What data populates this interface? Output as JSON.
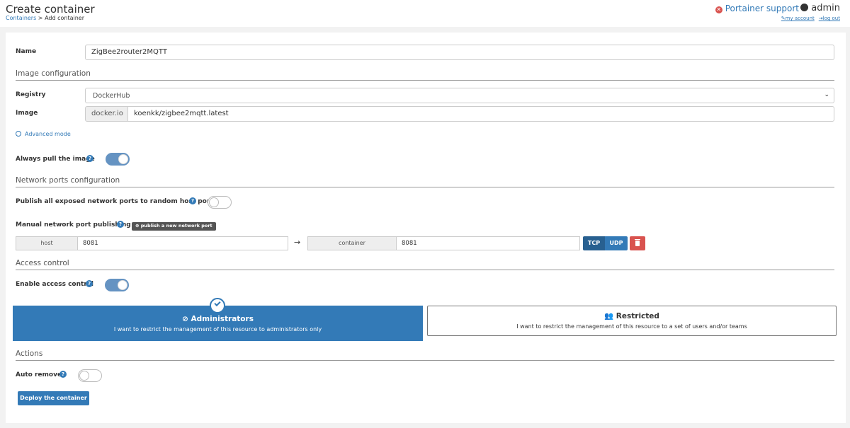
{
  "header": {
    "title": "Create container",
    "breadcrumb": {
      "link": "Containers",
      "separator": " > ",
      "current": "Add container"
    },
    "support_label": "Portainer support",
    "username": "admin",
    "my_account": "my account",
    "log_out": "log out"
  },
  "form": {
    "name_label": "Name",
    "name_value": "ZigBee2router2MQTT",
    "image_section": "Image configuration",
    "registry_label": "Registry",
    "registry_value": "DockerHub",
    "image_label": "Image",
    "image_prefix": "docker.io",
    "image_value": "koenkk/zigbee2mqtt.latest",
    "advanced_mode": "Advanced mode",
    "always_pull_label": "Always pull the image",
    "always_pull_on": true,
    "network_section": "Network ports configuration",
    "publish_all_label": "Publish all exposed network ports to random host ports",
    "publish_all_on": false,
    "manual_publish_label": "Manual network port publishing",
    "publish_new_port_button": "publish a new network port",
    "port": {
      "host_label": "host",
      "host_value": "8081",
      "container_label": "container",
      "container_value": "8081",
      "tcp": "TCP",
      "udp": "UDP"
    },
    "access_section": "Access control",
    "enable_access_label": "Enable access control",
    "enable_access_on": true,
    "admin_box": {
      "title": "Administrators",
      "description": "I want to restrict the management of this resource to administrators only"
    },
    "restricted_box": {
      "title": "Restricted",
      "description": "I want to restrict the management of this resource to a set of users and/or teams"
    },
    "actions_section": "Actions",
    "auto_remove_label": "Auto remove",
    "auto_remove_on": false,
    "deploy_button": "Deploy the container"
  },
  "colors": {
    "primary": "#337ab7",
    "danger": "#d9534f",
    "toggle_on": "#6593c2",
    "background": "#f2f2f2"
  }
}
